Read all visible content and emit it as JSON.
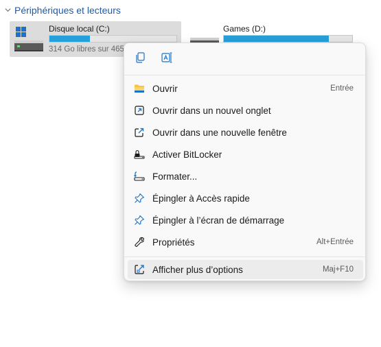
{
  "section": {
    "title": "Périphériques et lecteurs"
  },
  "drives": [
    {
      "name": "Disque local (C:)",
      "free_text": "314 Go libres sur 465",
      "usage": 0.32
    },
    {
      "name": "Games (D:)",
      "usage": 0.82
    }
  ],
  "colors": {
    "accent": "#1f5aa8",
    "bar_fill": "#26a0da",
    "icon_blue": "#1a73c9"
  },
  "menu": {
    "quick_actions": [
      {
        "icon": "copy-icon"
      },
      {
        "icon": "rename-icon"
      }
    ],
    "items": [
      {
        "label": "Ouvrir",
        "shortcut": "Entrée",
        "icon": "folder-icon"
      },
      {
        "label": "Ouvrir dans un nouvel onglet",
        "shortcut": "",
        "icon": "new-tab-icon"
      },
      {
        "label": "Ouvrir dans une nouvelle fenêtre",
        "shortcut": "",
        "icon": "new-window-icon"
      },
      {
        "label": "Activer BitLocker",
        "shortcut": "",
        "icon": "bitlocker-icon"
      },
      {
        "label": "Formater...",
        "shortcut": "",
        "icon": "format-icon"
      },
      {
        "label": "Épingler à Accès rapide",
        "shortcut": "",
        "icon": "pin-icon"
      },
      {
        "label": "Épingler à l’écran de démarrage",
        "shortcut": "",
        "icon": "pin-start-icon"
      },
      {
        "label": "Propriétés",
        "shortcut": "Alt+Entrée",
        "icon": "wrench-icon"
      },
      {
        "label": "Afficher plus d’options",
        "shortcut": "Maj+F10",
        "icon": "more-options-icon"
      }
    ]
  }
}
